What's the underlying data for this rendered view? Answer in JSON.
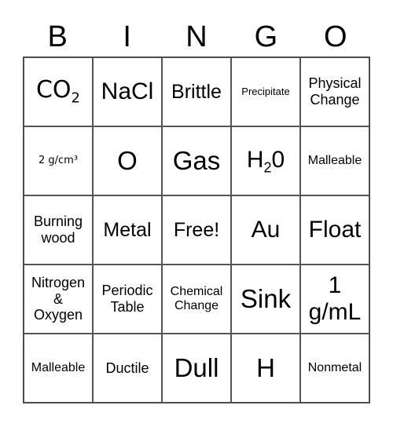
{
  "header": [
    "B",
    "I",
    "N",
    "G",
    "O"
  ],
  "cells": [
    {
      "text": "CO",
      "sub": "2",
      "size": "s-xl",
      "font": "calibri"
    },
    {
      "text": "NaCl",
      "size": "s-xl"
    },
    {
      "text": "Brittle",
      "size": "s-lg"
    },
    {
      "text": "Precipitate",
      "size": "s-xs"
    },
    {
      "text": "Physical\nChange",
      "size": "s-md"
    },
    {
      "text": "2 g/cm³",
      "size": "s-xs",
      "font": "calibri"
    },
    {
      "text": "O",
      "size": "s-xxl"
    },
    {
      "text": "Gas",
      "size": "s-xxl"
    },
    {
      "text": "H",
      "sub": "2",
      "after": "0",
      "size": "s-xl"
    },
    {
      "text": "Malleable",
      "size": "s-sm"
    },
    {
      "text": "Burning\nwood",
      "size": "s-md"
    },
    {
      "text": "Metal",
      "size": "s-lg"
    },
    {
      "text": "Free!",
      "size": "s-lg"
    },
    {
      "text": "Au",
      "size": "s-xl"
    },
    {
      "text": "Float",
      "size": "s-xl"
    },
    {
      "text": "Nitrogen\n&\nOxygen",
      "size": "s-md"
    },
    {
      "text": "Periodic\nTable",
      "size": "s-md"
    },
    {
      "text": "Chemical\nChange",
      "size": "s-sm"
    },
    {
      "text": "Sink",
      "size": "s-xxl"
    },
    {
      "text": "1\ng/mL",
      "size": "s-xl"
    },
    {
      "text": "Malleable",
      "size": "s-sm"
    },
    {
      "text": "Ductile",
      "size": "s-md"
    },
    {
      "text": "Dull",
      "size": "s-xxl"
    },
    {
      "text": "H",
      "size": "s-xxl"
    },
    {
      "text": "Nonmetal",
      "size": "s-sm"
    }
  ]
}
